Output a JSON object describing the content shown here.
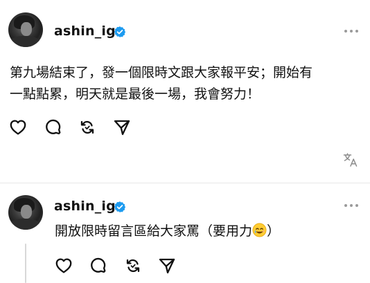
{
  "posts": [
    {
      "username": "ashin_ig",
      "text_line1": "第九場結束了，發一個限時文跟大家報平安；開始有",
      "text_line2": "一點點累，明天就是最後一場，我會努力！"
    },
    {
      "username": "ashin_ig",
      "text": "開放限時留言區給大家罵（要用力"
    }
  ],
  "icons": {
    "verified": "verified-badge-icon",
    "more": "more-options-icon",
    "like": "heart-icon",
    "comment": "comment-bubble-icon",
    "repost": "repost-icon",
    "share": "send-icon",
    "translate": "translate-icon",
    "emoji": "crying-smile-emoji"
  },
  "colors": {
    "verified_blue": "#1d9bf0",
    "text": "#111111",
    "icon": "#111111",
    "muted": "#9a9a9a",
    "divider": "#e7e7e7"
  }
}
